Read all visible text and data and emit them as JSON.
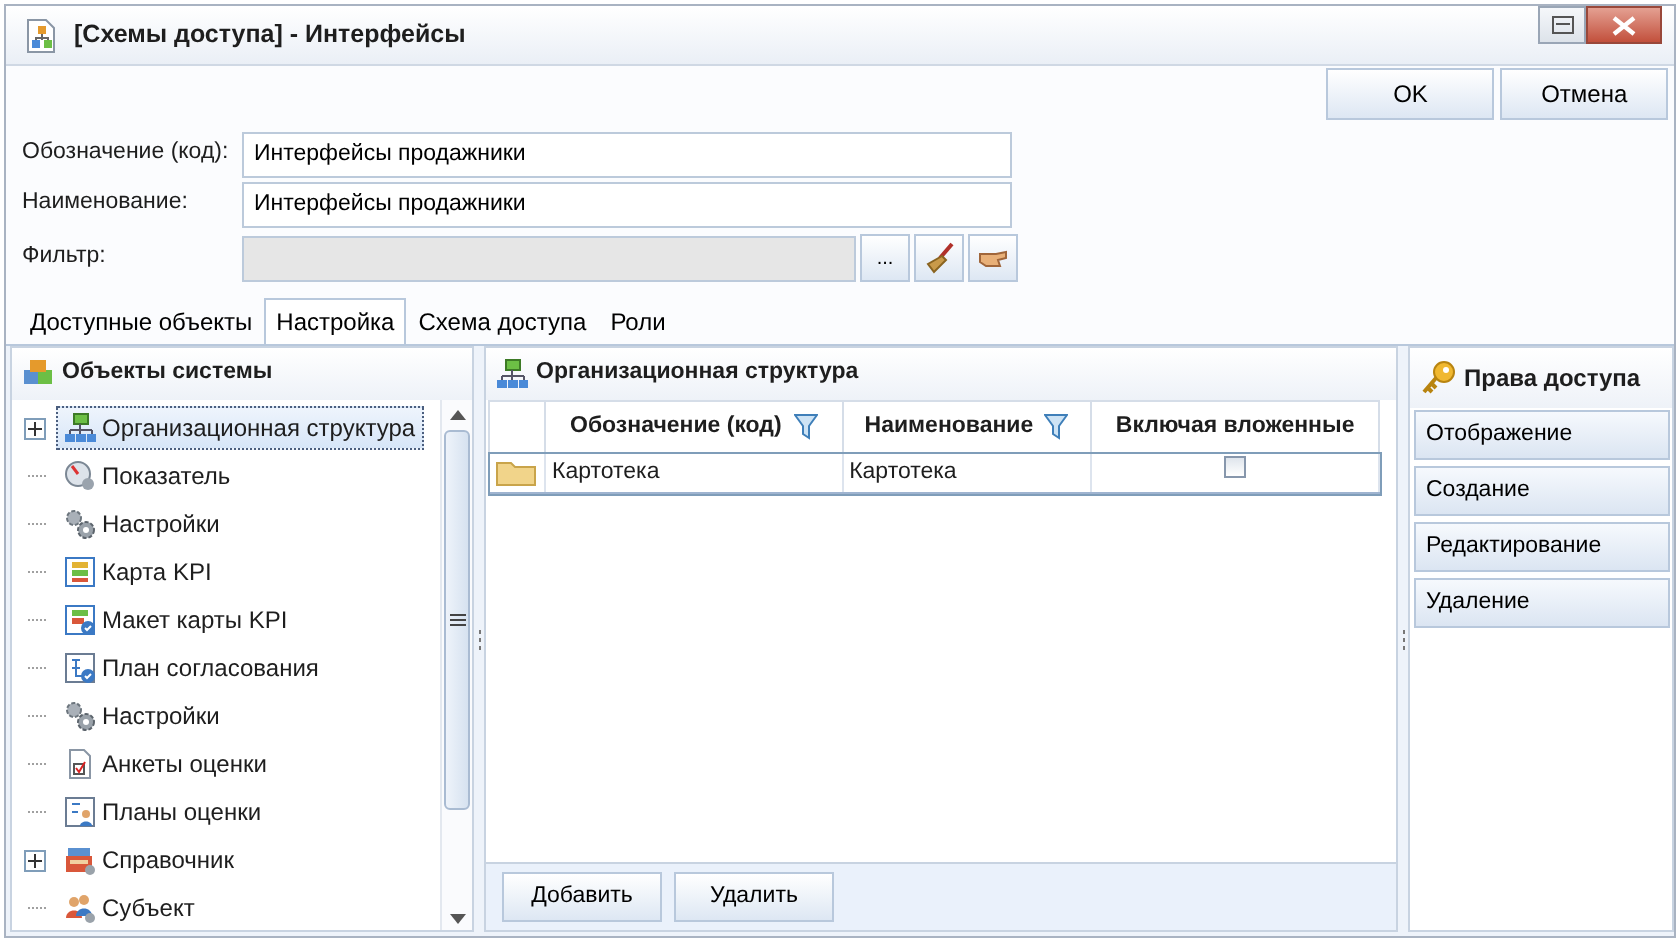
{
  "window": {
    "title": "[Схемы доступа] - Интерфейсы"
  },
  "dialog_buttons": [
    "OK",
    "Отмена"
  ],
  "fields": [
    {
      "label": "Обозначение (код):",
      "value": "Интерфейсы продажники",
      "disabled": false
    },
    {
      "label": "Наименование:",
      "value": "Интерфейсы продажники",
      "disabled": false
    },
    {
      "label": "Фильтр:",
      "disabled": true
    }
  ],
  "filter_button": "...",
  "tabs": [
    {
      "label": "Доступные объекты",
      "selected": false
    },
    {
      "label": "Настройка",
      "selected": true
    },
    {
      "label": "Схема доступа",
      "selected": false
    },
    {
      "label": "Роли",
      "selected": false
    }
  ],
  "objects_panel": {
    "title": "Объекты системы",
    "items": [
      {
        "label": "Организационная структура",
        "kind": "org",
        "expandable": true,
        "selected": true
      },
      {
        "label": "Показатель",
        "kind": "gauge",
        "expandable": false,
        "selected": false
      },
      {
        "label": "Настройки",
        "kind": "gears",
        "expandable": false,
        "selected": false
      },
      {
        "label": "Карта KPI",
        "kind": "card",
        "expandable": false,
        "selected": false
      },
      {
        "label": "Макет карты KPI",
        "kind": "template",
        "expandable": false,
        "selected": false
      },
      {
        "label": "План согласования",
        "kind": "plan",
        "expandable": false,
        "selected": false
      },
      {
        "label": "Настройки",
        "kind": "gears",
        "expandable": false,
        "selected": false
      },
      {
        "label": "Анкеты оценки",
        "kind": "form",
        "expandable": false,
        "selected": false
      },
      {
        "label": "Планы оценки",
        "kind": "team",
        "expandable": false,
        "selected": false
      },
      {
        "label": "Справочник",
        "kind": "catalog",
        "expandable": true,
        "selected": false
      },
      {
        "label": "Субъект",
        "kind": "people",
        "expandable": false,
        "selected": false
      }
    ]
  },
  "structure_panel": {
    "title": "Организационная структура",
    "columns": [
      {
        "label": "Обозначение (код)",
        "filter": true
      },
      {
        "label": "Наименование",
        "filter": true
      },
      {
        "label": "Включая вложенные",
        "filter": false
      }
    ],
    "rows": [
      {
        "code": "Картотека",
        "name": "Картотека",
        "include_nested": false,
        "selected": true
      }
    ],
    "buttons": [
      "Добавить",
      "Удалить"
    ]
  },
  "rights_panel": {
    "title": "Права доступа",
    "buttons": [
      "Отображение",
      "Создание",
      "Редактирование",
      "Удаление"
    ]
  }
}
